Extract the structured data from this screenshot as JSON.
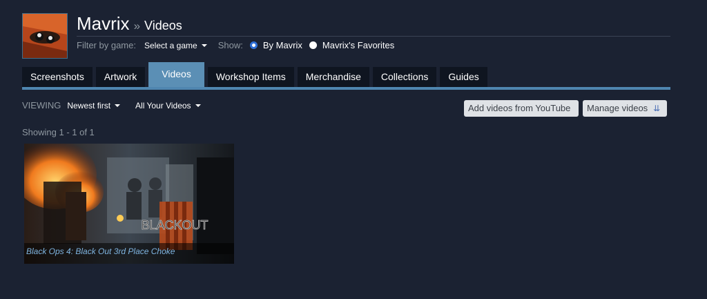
{
  "profile": {
    "name": "Mavrix",
    "separator": "»",
    "section": "Videos",
    "avatar_icon": "game-controller-avatar"
  },
  "filters": {
    "filter_label": "Filter by game:",
    "game_select": "Select a game",
    "show_label": "Show:",
    "options": [
      {
        "label": "By Mavrix",
        "checked": true
      },
      {
        "label": "Mavrix's Favorites",
        "checked": false
      }
    ]
  },
  "tabs": [
    {
      "label": "Screenshots",
      "active": false
    },
    {
      "label": "Artwork",
      "active": false
    },
    {
      "label": "Videos",
      "active": true
    },
    {
      "label": "Workshop Items",
      "active": false
    },
    {
      "label": "Merchandise",
      "active": false
    },
    {
      "label": "Collections",
      "active": false
    },
    {
      "label": "Guides",
      "active": false
    }
  ],
  "toolbar": {
    "viewing_label": "VIEWING",
    "sort_select": "Newest first",
    "scope_select": "All Your Videos",
    "add_button": "Add videos from YouTube",
    "manage_button": "Manage videos"
  },
  "results": {
    "showing_text": "Showing 1 - 1 of 1"
  },
  "videos": [
    {
      "title": "Black Ops 4: Black Out 3rd Place Choke",
      "thumbnail_logo": "BLACKOUT"
    }
  ],
  "colors": {
    "background": "#1b2232",
    "tab_active": "#5b8fb5",
    "tab_inactive": "#0f1520",
    "accent_rule": "#4f86b0",
    "link_blue": "#7fb4e0"
  }
}
